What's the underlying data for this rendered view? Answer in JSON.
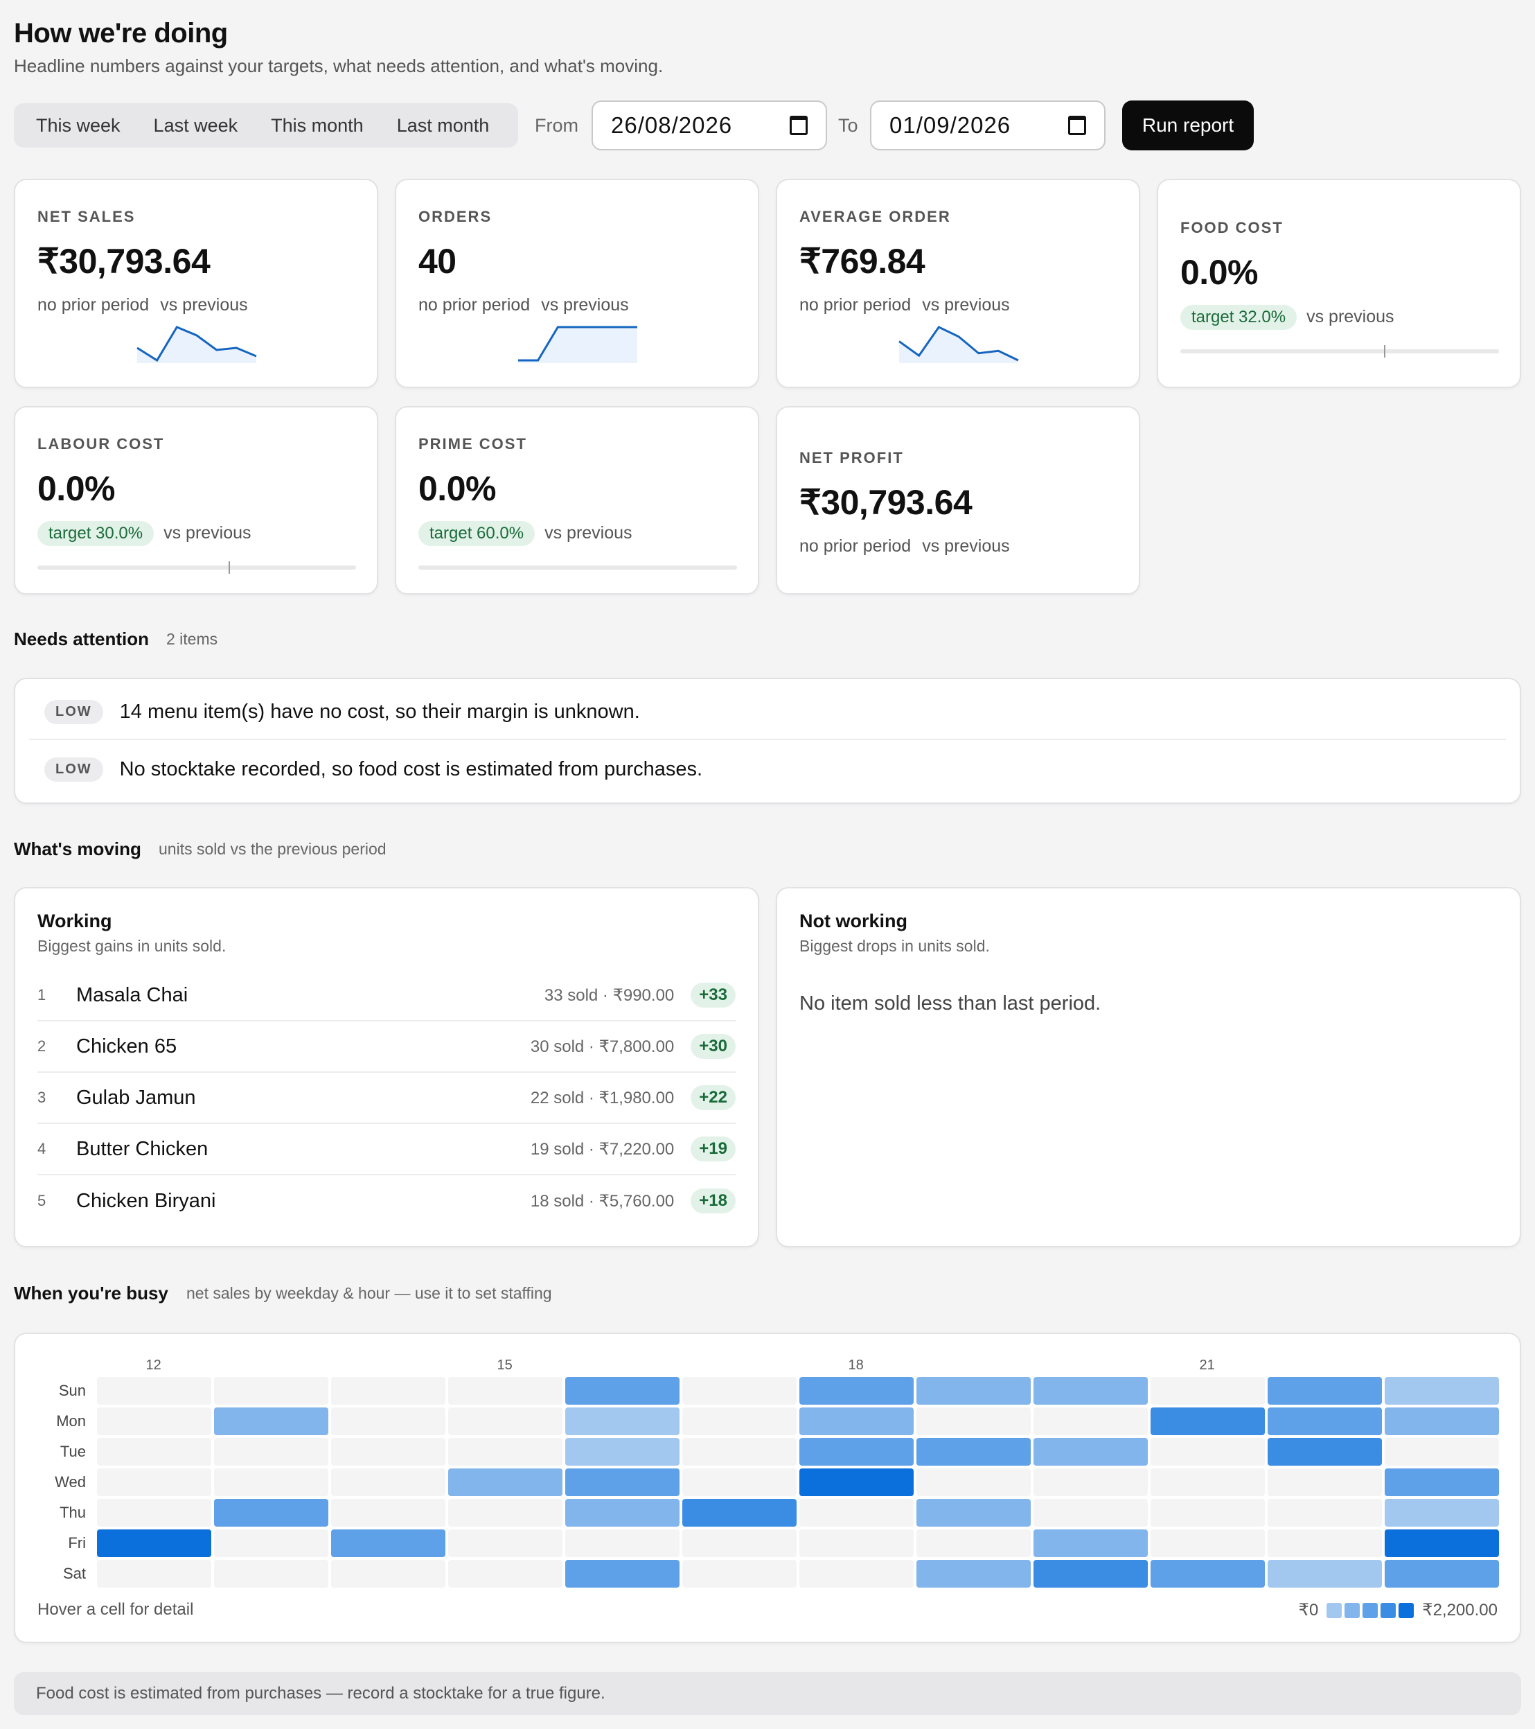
{
  "header": {
    "title": "How we're doing",
    "subtitle": "Headline numbers against your targets, what needs attention, and what's moving."
  },
  "toolbar": {
    "periods": [
      "This week",
      "Last week",
      "This month",
      "Last month"
    ],
    "from_label": "From",
    "from_value": "26/08/2026",
    "to_label": "To",
    "to_value": "01/09/2026",
    "run_label": "Run report"
  },
  "kpis": {
    "net_sales": {
      "label": "NET SALES",
      "value": "₹30,793.64",
      "note": "no prior period",
      "vs": "vs previous",
      "trend": [
        10,
        4,
        20,
        16,
        9,
        10,
        6
      ]
    },
    "orders": {
      "label": "ORDERS",
      "value": "40",
      "note": "no prior period",
      "vs": "vs previous",
      "trend": [
        0,
        0,
        10,
        10,
        10,
        10,
        10
      ]
    },
    "average_order": {
      "label": "AVERAGE ORDER",
      "value": "₹769.84",
      "note": "no prior period",
      "vs": "vs previous",
      "trend": [
        12,
        6,
        18,
        14,
        7,
        8,
        4
      ]
    },
    "food_cost": {
      "label": "FOOD COST",
      "value": "0.0%",
      "target": "target 32.0%",
      "vs": "vs previous",
      "actual_pct": 0,
      "target_pct": 32
    },
    "labour_cost": {
      "label": "LABOUR COST",
      "value": "0.0%",
      "target": "target 30.0%",
      "vs": "vs previous",
      "actual_pct": 0,
      "target_pct": 30
    },
    "prime_cost": {
      "label": "PRIME COST",
      "value": "0.0%",
      "target": "target 60.0%",
      "vs": "vs previous",
      "actual_pct": 0,
      "target_pct": 60
    },
    "net_profit": {
      "label": "NET PROFIT",
      "value": "₹30,793.64",
      "note": "no prior period",
      "vs": "vs previous"
    }
  },
  "attention": {
    "title": "Needs attention",
    "count": "2 items",
    "items": [
      {
        "level": "LOW",
        "text": "14 menu item(s) have no cost, so their margin is unknown."
      },
      {
        "level": "LOW",
        "text": "No stocktake recorded, so food cost is estimated from purchases."
      }
    ]
  },
  "moving": {
    "title": "What's moving",
    "subtitle": "units sold vs the previous period",
    "working": {
      "title": "Working",
      "subtitle": "Biggest gains in units sold.",
      "items": [
        {
          "rank": "1",
          "name": "Masala Chai",
          "meta": "33 sold · ₹990.00",
          "delta": "+33"
        },
        {
          "rank": "2",
          "name": "Chicken 65",
          "meta": "30 sold · ₹7,800.00",
          "delta": "+30"
        },
        {
          "rank": "3",
          "name": "Gulab Jamun",
          "meta": "22 sold · ₹1,980.00",
          "delta": "+22"
        },
        {
          "rank": "4",
          "name": "Butter Chicken",
          "meta": "19 sold · ₹7,220.00",
          "delta": "+19"
        },
        {
          "rank": "5",
          "name": "Chicken Biryani",
          "meta": "18 sold · ₹5,760.00",
          "delta": "+18"
        }
      ]
    },
    "not_working": {
      "title": "Not working",
      "subtitle": "Biggest drops in units sold.",
      "empty": "No item sold less than last period."
    }
  },
  "busy": {
    "title": "When you're busy",
    "subtitle": "net sales by weekday & hour — use it to set staffing",
    "hover_hint": "Hover a cell for detail",
    "legend_min": "₹0",
    "legend_max": "₹2,200.00",
    "colors": [
      "#f4f4f5",
      "#c6dcf5",
      "#a3c8f0",
      "#82b5ec",
      "#5ea1e8",
      "#3a8de3",
      "#0b6fdc"
    ]
  },
  "chart_data": {
    "type": "heatmap",
    "title": "When you're busy",
    "x_tick_labels": [
      "12",
      "15",
      "18",
      "21"
    ],
    "x": [
      12,
      13,
      14,
      15,
      16,
      17,
      18,
      19,
      20,
      21,
      22,
      23
    ],
    "y": [
      "Sun",
      "Mon",
      "Tue",
      "Wed",
      "Thu",
      "Fri",
      "Sat"
    ],
    "value_range": [
      0,
      2200
    ],
    "values": [
      [
        0,
        0,
        0,
        0,
        1300,
        0,
        1300,
        900,
        1100,
        0,
        1300,
        600
      ],
      [
        0,
        1100,
        0,
        0,
        600,
        0,
        800,
        0,
        0,
        1600,
        1200,
        900
      ],
      [
        0,
        0,
        0,
        0,
        400,
        0,
        1300,
        1300,
        900,
        0,
        1500,
        0
      ],
      [
        0,
        0,
        0,
        800,
        1300,
        0,
        2200,
        0,
        0,
        0,
        0,
        1300
      ],
      [
        0,
        1200,
        0,
        0,
        800,
        1500,
        0,
        900,
        0,
        0,
        0,
        700
      ],
      [
        2000,
        0,
        1200,
        0,
        0,
        0,
        0,
        0,
        1100,
        0,
        0,
        2100
      ],
      [
        0,
        0,
        0,
        0,
        1300,
        0,
        0,
        1000,
        1500,
        1200,
        700,
        1400
      ]
    ]
  },
  "footer": {
    "note": "Food cost is estimated from purchases — record a stocktake for a true figure."
  }
}
